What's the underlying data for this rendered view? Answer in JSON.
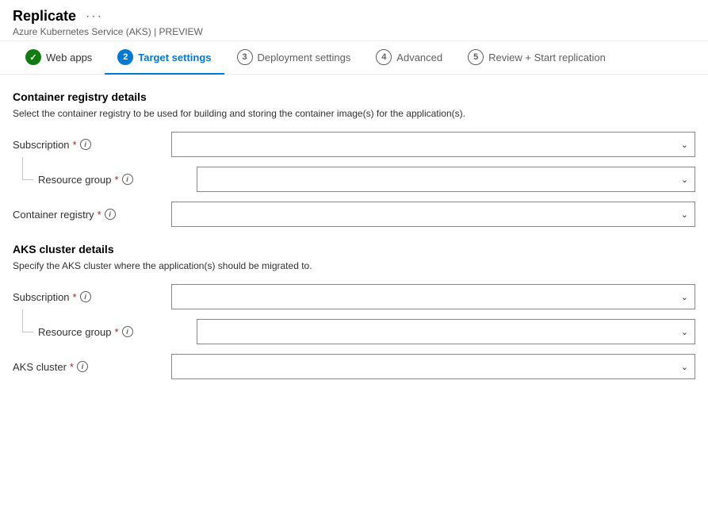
{
  "header": {
    "title": "Replicate",
    "subtitle": "Azure Kubernetes Service (AKS)",
    "subtitle_suffix": "| PREVIEW"
  },
  "tabs": [
    {
      "id": "web-apps",
      "number": "",
      "state": "completed",
      "label": "Web apps"
    },
    {
      "id": "target-settings",
      "number": "2",
      "state": "active",
      "label": "Target settings"
    },
    {
      "id": "deployment-settings",
      "number": "3",
      "state": "inactive",
      "label": "Deployment settings"
    },
    {
      "id": "advanced",
      "number": "4",
      "state": "inactive",
      "label": "Advanced"
    },
    {
      "id": "review-start",
      "number": "5",
      "state": "inactive",
      "label": "Review + Start replication"
    }
  ],
  "container_registry": {
    "section_title": "Container registry details",
    "section_desc_part1": "Select the container registry to be used for building and storing the container image(s) for the application(s).",
    "subscription_label": "Subscription",
    "resource_group_label": "Resource group",
    "container_registry_label": "Container registry"
  },
  "aks_cluster": {
    "section_title": "AKS cluster details",
    "section_desc": "Specify the AKS cluster where the application(s) should be migrated to.",
    "subscription_label": "Subscription",
    "resource_group_label": "Resource group",
    "aks_cluster_label": "AKS cluster"
  },
  "icons": {
    "check": "✓",
    "chevron_down": "∨",
    "info": "i",
    "ellipsis": "···"
  }
}
